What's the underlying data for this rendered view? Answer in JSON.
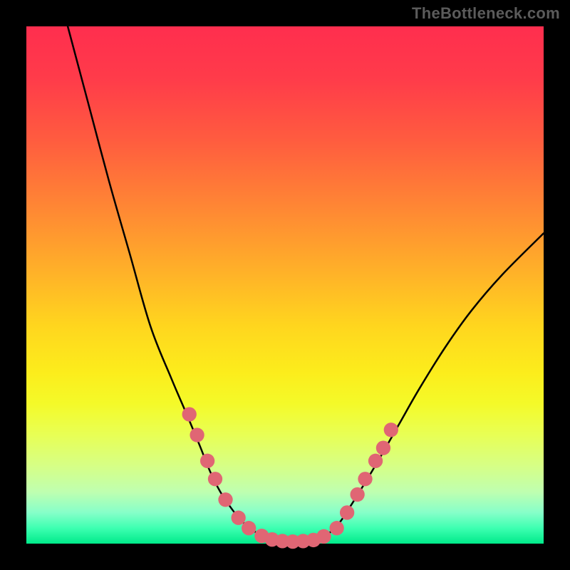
{
  "watermark": "TheBottleneck.com",
  "chart_data": {
    "type": "line",
    "title": "",
    "xlabel": "",
    "ylabel": "",
    "xlim": [
      0,
      100
    ],
    "ylim": [
      0,
      100
    ],
    "grid": false,
    "legend": false,
    "series": [
      {
        "name": "left-curve",
        "x": [
          8,
          12,
          16,
          20,
          24,
          28,
          31,
          33.5,
          35.5,
          37.5,
          39.5,
          41.5,
          43.5,
          45.5,
          47.5
        ],
        "values": [
          100,
          85,
          70,
          56,
          42,
          32,
          25,
          19,
          14,
          10,
          7,
          4.5,
          2.8,
          1.5,
          0.8
        ]
      },
      {
        "name": "flat-bottom",
        "x": [
          47.5,
          49,
          51,
          53,
          55,
          56.5
        ],
        "values": [
          0.8,
          0.5,
          0.4,
          0.4,
          0.5,
          0.8
        ]
      },
      {
        "name": "right-curve",
        "x": [
          56.5,
          58.5,
          60.5,
          62.5,
          65,
          68,
          72,
          76,
          81,
          86,
          92,
          100
        ],
        "values": [
          0.8,
          2,
          4,
          7,
          11,
          16,
          23,
          30,
          38,
          45,
          52,
          60
        ]
      }
    ],
    "markers": {
      "name": "highlight-dots",
      "color": "#e06674",
      "radius_rel": 1.4,
      "points": [
        {
          "x": 31.5,
          "y": 25
        },
        {
          "x": 33.0,
          "y": 21
        },
        {
          "x": 35.0,
          "y": 16
        },
        {
          "x": 36.5,
          "y": 12.5
        },
        {
          "x": 38.5,
          "y": 8.5
        },
        {
          "x": 41.0,
          "y": 5
        },
        {
          "x": 43.0,
          "y": 3
        },
        {
          "x": 45.5,
          "y": 1.5
        },
        {
          "x": 47.5,
          "y": 0.8
        },
        {
          "x": 49.5,
          "y": 0.5
        },
        {
          "x": 51.5,
          "y": 0.4
        },
        {
          "x": 53.5,
          "y": 0.5
        },
        {
          "x": 55.5,
          "y": 0.7
        },
        {
          "x": 57.5,
          "y": 1.4
        },
        {
          "x": 60.0,
          "y": 3.0
        },
        {
          "x": 62.0,
          "y": 6.0
        },
        {
          "x": 64.0,
          "y": 9.5
        },
        {
          "x": 65.5,
          "y": 12.5
        },
        {
          "x": 67.5,
          "y": 16.0
        },
        {
          "x": 69.0,
          "y": 18.5
        },
        {
          "x": 70.5,
          "y": 22.0
        }
      ]
    }
  }
}
